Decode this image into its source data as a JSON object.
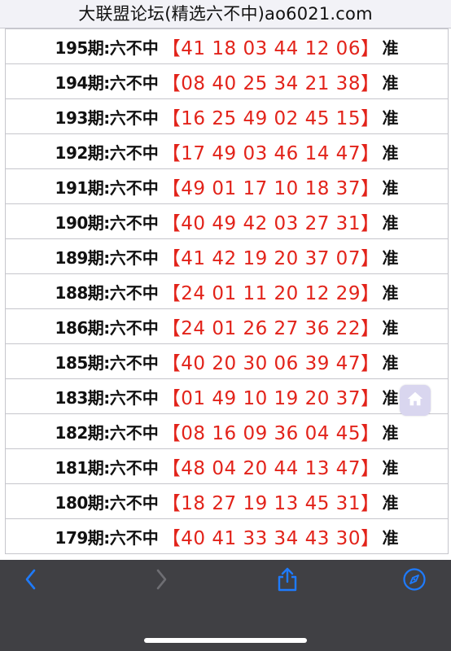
{
  "header": {
    "title": "大联盟论坛(精选六不中)ao6021.com"
  },
  "rows": [
    {
      "period": "195期:",
      "label": "六不中",
      "numbers": "【41 18 03 44 12 06】",
      "result": "准"
    },
    {
      "period": "194期:",
      "label": "六不中",
      "numbers": "【08 40 25 34 21 38】",
      "result": "准"
    },
    {
      "period": "193期:",
      "label": "六不中",
      "numbers": "【16 25 49 02 45 15】",
      "result": "准"
    },
    {
      "period": "192期:",
      "label": "六不中",
      "numbers": "【17 49 03 46 14 47】",
      "result": "准"
    },
    {
      "period": "191期:",
      "label": "六不中",
      "numbers": "【49 01 17 10 18 37】",
      "result": "准"
    },
    {
      "period": "190期:",
      "label": "六不中",
      "numbers": "【40 49 42 03 27 31】",
      "result": "准"
    },
    {
      "period": "189期:",
      "label": "六不中",
      "numbers": "【41 42 19 20 37 07】",
      "result": "准"
    },
    {
      "period": "188期:",
      "label": "六不中",
      "numbers": "【24 01 11 20 12 29】",
      "result": "准"
    },
    {
      "period": "186期:",
      "label": "六不中",
      "numbers": "【24 01 26 27 36 22】",
      "result": "准"
    },
    {
      "period": "185期:",
      "label": "六不中",
      "numbers": "【40 20 30 06 39 47】",
      "result": "准"
    },
    {
      "period": "183期:",
      "label": "六不中",
      "numbers": "【01 49 10 19 20 37】",
      "result": "准"
    },
    {
      "period": "182期:",
      "label": "六不中",
      "numbers": "【08 16 09 36 04 45】",
      "result": "准"
    },
    {
      "period": "181期:",
      "label": "六不中",
      "numbers": "【48 04 20 44 13 47】",
      "result": "准"
    },
    {
      "period": "180期:",
      "label": "六不中",
      "numbers": "【18 27 19 13 45 31】",
      "result": "准"
    },
    {
      "period": "179期:",
      "label": "六不中",
      "numbers": "【40 41 33 34 43 30】",
      "result": "准"
    }
  ],
  "toolbar": {
    "back_icon": "chevron-left-icon",
    "forward_icon": "chevron-right-icon",
    "share_icon": "share-icon",
    "browser_icon": "compass-icon"
  },
  "colors": {
    "numbers": "#e2231a",
    "toolbar": "#3a3a3e",
    "accent": "#1e7bff"
  }
}
